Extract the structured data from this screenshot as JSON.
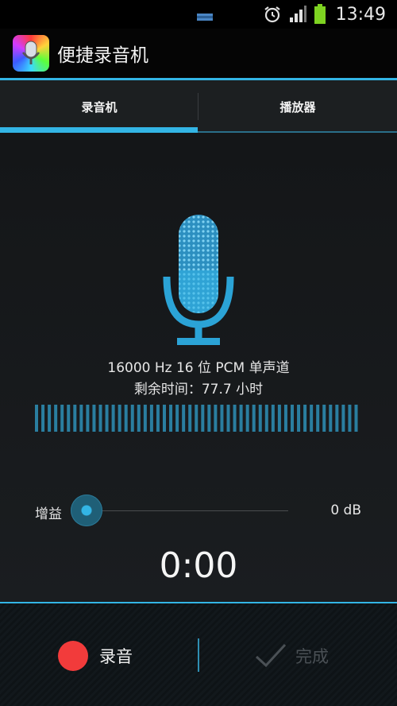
{
  "status_bar": {
    "time": "13:49",
    "icons": [
      "notification-icon",
      "alarm-icon",
      "signal-icon",
      "battery-icon"
    ],
    "battery_color": "#7ed321"
  },
  "app": {
    "title": "便捷录音机",
    "icon": "app-microphone-icon"
  },
  "tabs": [
    {
      "label": "录音机",
      "selected": true
    },
    {
      "label": "播放器",
      "selected": false
    }
  ],
  "recorder": {
    "format_text": "16000 Hz 16 位 PCM 单声道",
    "remaining_text": "剩余时间：77.7 小时",
    "gain_label": "增益",
    "gain_value": "0 dB",
    "gain_level": 0,
    "timer": "0:00"
  },
  "bottom_bar": {
    "record_label": "录音",
    "done_label": "完成",
    "done_enabled": false
  },
  "colors": {
    "accent": "#33b5e5",
    "record": "#f23b3b",
    "disabled": "#4a5055"
  }
}
